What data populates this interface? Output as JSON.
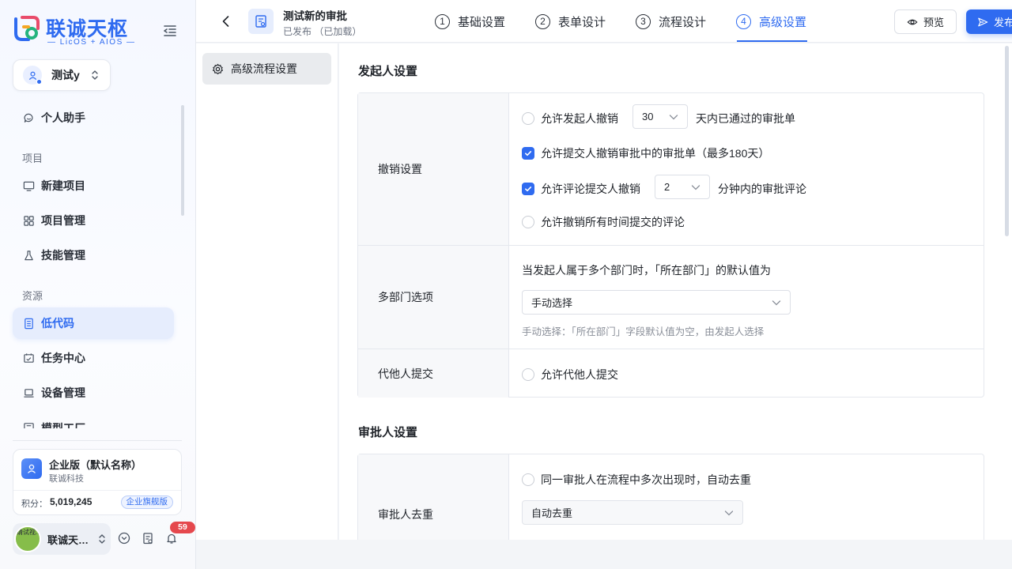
{
  "brand": {
    "name": "联诚天枢",
    "tagline": "— LicOS + AIOS —",
    "colors": {
      "primary": "#2f6bf0",
      "danger": "#e5484d"
    }
  },
  "workspace": {
    "name": "测试y"
  },
  "nav": {
    "assistant": "个人助手",
    "group_project": "项目",
    "new_project": "新建项目",
    "project_mgmt": "项目管理",
    "skill_mgmt": "技能管理",
    "group_resource": "资源",
    "lowcode": "低代码",
    "task_center": "任务中心",
    "device_mgmt": "设备管理",
    "model_factory": "模型工厂"
  },
  "enterprise": {
    "name": "企业版（默认名称）",
    "org": "联诚科技",
    "points_label": "积分：",
    "points": "5,019,245",
    "badge": "企业旗舰版"
  },
  "user": {
    "name": "联诚天…",
    "avatar_text": "请试视...",
    "notifications": "59"
  },
  "header": {
    "title": "测试新的审批",
    "status": "已发布  （已加载）",
    "steps": [
      {
        "num": "1",
        "label": "基础设置"
      },
      {
        "num": "2",
        "label": "表单设计"
      },
      {
        "num": "3",
        "label": "流程设计"
      },
      {
        "num": "4",
        "label": "高级设置"
      }
    ],
    "preview": "预览",
    "publish": "发布"
  },
  "settings_menu": {
    "item": "高级流程设置"
  },
  "initiator": {
    "title": "发起人设置",
    "revoke": {
      "label": "撤销设置",
      "opt1_prefix": "允许发起人撤销",
      "opt1_days": "30",
      "opt1_suffix": "天内已通过的审批单",
      "opt2": "允许提交人撤销审批中的审批单（最多180天）",
      "opt3_prefix": "允许评论提交人撤销",
      "opt3_minutes": "2",
      "opt3_suffix": "分钟内的审批评论",
      "opt4": "允许撤销所有时间提交的评论"
    },
    "multi_dept": {
      "label": "多部门选项",
      "question": "当发起人属于多个部门时，「所在部门」的默认值为",
      "value": "手动选择",
      "hint": "手动选择：「所在部门」字段默认值为空，由发起人选择"
    },
    "proxy": {
      "label": "代他人提交",
      "option": "允许代他人提交"
    }
  },
  "approver": {
    "title": "审批人设置",
    "dedup": {
      "label": "审批人去重",
      "option": "同一审批人在流程中多次出现时，自动去重",
      "value": "自动去重"
    }
  }
}
